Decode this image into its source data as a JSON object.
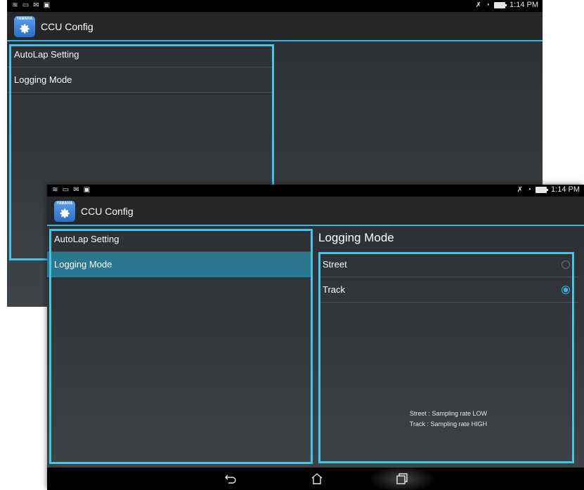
{
  "screens": {
    "back": {
      "status_time": "1:14 PM",
      "app": {
        "brand": "YAMAHA",
        "title": "CCU Config"
      },
      "menu": [
        "AutoLap Setting",
        "Logging Mode"
      ]
    },
    "front": {
      "status_time": "1:14 PM",
      "app": {
        "brand": "YAMAHA",
        "title": "CCU Config"
      },
      "menu": [
        "AutoLap Setting",
        "Logging Mode"
      ],
      "selected_menu_index": 1,
      "panel": {
        "heading": "Logging Mode",
        "options": [
          {
            "label": "Street",
            "selected": false
          },
          {
            "label": "Track",
            "selected": true
          }
        ],
        "help_lines": [
          "Street : Sampling rate LOW",
          "Track : Sampling rate HIGH"
        ]
      }
    }
  },
  "colors": {
    "accent": "#33b5e5",
    "highlight": "#3fc6e8",
    "selected_row": "#29788f"
  },
  "icons": [
    "wifi-icon",
    "tray-icon",
    "mail-icon",
    "image-icon",
    "muted-icon",
    "wifi-signal-icon",
    "battery-icon",
    "gear-icon",
    "back-icon",
    "home-icon",
    "recents-icon"
  ]
}
